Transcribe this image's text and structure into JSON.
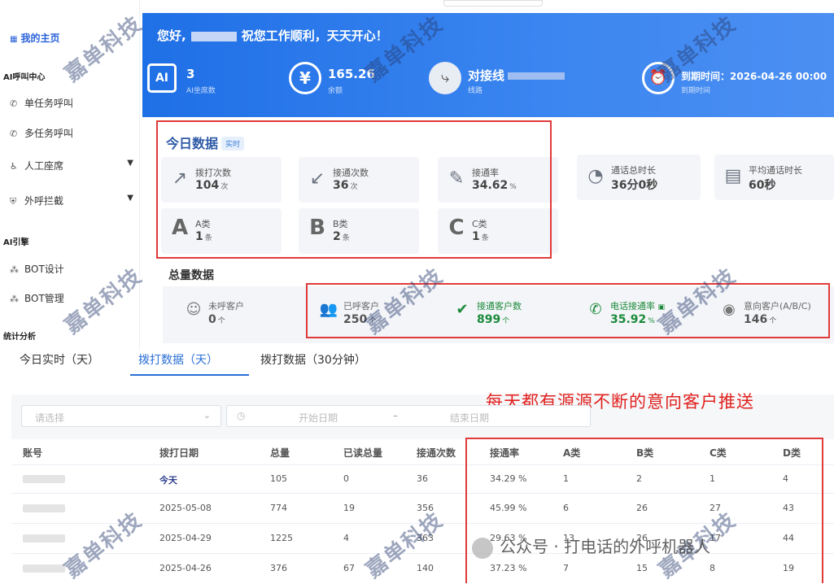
{
  "sidebar": {
    "home": "我的主页",
    "groups": [
      {
        "title": "AI呼叫中心"
      },
      {
        "title": "AI引擎"
      },
      {
        "title": "统计分析"
      }
    ],
    "items": [
      {
        "label": "单任务呼叫",
        "icon": "phone-icon"
      },
      {
        "label": "多任务呼叫",
        "icon": "phone-forward-icon"
      },
      {
        "label": "人工座席",
        "icon": "agent-icon"
      },
      {
        "label": "外呼拦截",
        "icon": "shield-icon"
      },
      {
        "label": "BOT设计",
        "icon": "nodes-icon"
      },
      {
        "label": "BOT管理",
        "icon": "nodes-icon"
      }
    ]
  },
  "banner": {
    "greeting_prefix": "您好,",
    "greeting_suffix": "祝您工作顺利，天天开心！",
    "ai_icon_label": "AI",
    "stats": [
      {
        "value": "3",
        "label": "AI坐席数"
      },
      {
        "value": "165.26",
        "label": "余额"
      },
      {
        "value": "对接线",
        "label": "线路"
      },
      {
        "value": "到期时间：2026-04-26 00:00",
        "label": "到期时间"
      }
    ]
  },
  "today": {
    "title": "今日数据",
    "badge": "实时",
    "cards": [
      {
        "label": "拨打次数",
        "value": "104",
        "unit": "次"
      },
      {
        "label": "接通次数",
        "value": "36",
        "unit": "次"
      },
      {
        "label": "接通率",
        "value": "34.62",
        "unit": "%"
      },
      {
        "label": "通话总时长",
        "value": "36分0秒",
        "unit": ""
      },
      {
        "label": "平均通话时长",
        "value": "60秒",
        "unit": ""
      },
      {
        "label": "A类",
        "value": "1",
        "unit": "条",
        "letter": "A"
      },
      {
        "label": "B类",
        "value": "2",
        "unit": "条",
        "letter": "B"
      },
      {
        "label": "C类",
        "value": "1",
        "unit": "条",
        "letter": "C"
      }
    ]
  },
  "total": {
    "title": "总量数据",
    "items": [
      {
        "label": "未呼客户",
        "value": "0",
        "unit": "个"
      },
      {
        "label": "已呼客户",
        "value": "250",
        "unit": "个"
      },
      {
        "label": "接通客户数",
        "value": "899",
        "unit": "个"
      },
      {
        "label": "电话接通率",
        "value": "35.92",
        "unit": "%"
      },
      {
        "label": "意向客户(A/B/C)",
        "value": "146",
        "unit": "个"
      }
    ]
  },
  "tabs": [
    "今日实时（天）",
    "拨打数据（天）",
    "拨打数据（30分钟）"
  ],
  "promo": "每天都有源源不断的意向客户推送",
  "filters": {
    "select_placeholder": "请选择",
    "start_placeholder": "开始日期",
    "separator": "–",
    "end_placeholder": "结束日期"
  },
  "table": {
    "headers": [
      "账号",
      "拨打日期",
      "总量",
      "已读总量",
      "接通次数",
      "接通率",
      "A类",
      "B类",
      "C类",
      "D类"
    ],
    "rows": [
      {
        "date": "今天",
        "total": "105",
        "read": "0",
        "connected": "36",
        "rate": "34.29 %",
        "a": "1",
        "b": "2",
        "c": "1",
        "d": "4"
      },
      {
        "date": "2025-05-08",
        "total": "774",
        "read": "19",
        "connected": "356",
        "rate": "45.99 %",
        "a": "6",
        "b": "26",
        "c": "27",
        "d": "43"
      },
      {
        "date": "2025-04-29",
        "total": "1225",
        "read": "4",
        "connected": "363",
        "rate": "29.63 %",
        "a": "13",
        "b": "26",
        "c": "17",
        "d": "44"
      },
      {
        "date": "2025-04-26",
        "total": "376",
        "read": "67",
        "connected": "140",
        "rate": "37.23 %",
        "a": "7",
        "b": "15",
        "c": "8",
        "d": "19"
      }
    ]
  },
  "watermark": "嘉单科技",
  "wechat_caption": "公众号 · 打电话的外呼机器人"
}
